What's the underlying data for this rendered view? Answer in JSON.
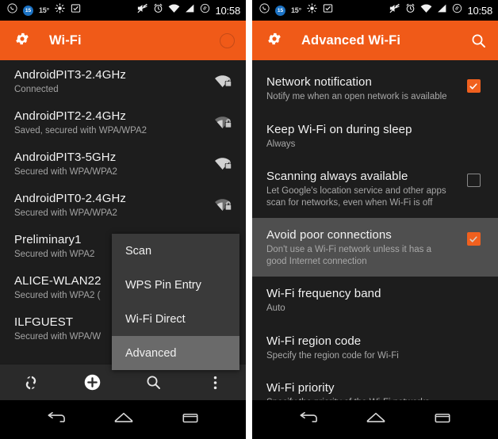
{
  "statusbar": {
    "icons_left": [
      "whatsapp-icon",
      "message-badge-icon",
      "temperature-label",
      "sun-gear-icon",
      "checkbox-app-icon"
    ],
    "temperature": "15°",
    "icons_right": [
      "mute-icon",
      "alarm-icon",
      "wifi-icon",
      "signal-icon",
      "circle-icon"
    ],
    "clock": "10:58",
    "badge_text": "15"
  },
  "left": {
    "actionbar": {
      "icon": "gear-icon",
      "title": "Wi-Fi",
      "right_icon": "progress-ring-icon"
    },
    "networks": [
      {
        "ssid": "AndroidPIT3-2.4GHz",
        "status": "Connected",
        "icon": "wifi-lock-icon",
        "bars": 4
      },
      {
        "ssid": "AndroidPIT2-2.4GHz",
        "status": "Saved, secured with WPA/WPA2",
        "icon": "wifi-lock-icon",
        "bars": 3
      },
      {
        "ssid": "AndroidPIT3-5GHz",
        "status": "Secured with WPA/WPA2",
        "icon": "wifi-lock-icon",
        "bars": 4
      },
      {
        "ssid": "AndroidPIT0-2.4GHz",
        "status": "Secured with WPA/WPA2",
        "icon": "wifi-lock-icon",
        "bars": 3
      },
      {
        "ssid": "Preliminary1",
        "status": "Secured with WPA2",
        "icon": "wifi-lock-icon",
        "bars": 3
      },
      {
        "ssid": "ALICE-WLAN22",
        "status": "Secured with WPA2 (",
        "icon": "wifi-lock-icon",
        "bars": 2
      },
      {
        "ssid": "ILFGUEST",
        "status": "Secured with WPA/W",
        "icon": "wifi-lock-icon",
        "bars": 2
      }
    ],
    "menu": {
      "items": [
        {
          "label": "Scan",
          "selected": false
        },
        {
          "label": "WPS Pin Entry",
          "selected": false
        },
        {
          "label": "Wi-Fi Direct",
          "selected": false
        },
        {
          "label": "Advanced",
          "selected": true
        }
      ]
    },
    "toolbar": [
      {
        "name": "refresh-icon"
      },
      {
        "name": "add-network-icon"
      },
      {
        "name": "search-icon"
      },
      {
        "name": "overflow-menu-icon"
      }
    ]
  },
  "right": {
    "actionbar": {
      "icon": "gear-icon",
      "title": "Advanced Wi-Fi",
      "right_icon": "search-icon"
    },
    "settings": [
      {
        "title": "Network notification",
        "sub": "Notify me when an open network is available",
        "control": "checkbox",
        "checked": true,
        "pressed": false
      },
      {
        "title": "Keep Wi-Fi on during sleep",
        "sub": "Always",
        "control": "none",
        "checked": false,
        "pressed": false
      },
      {
        "title": "Scanning always available",
        "sub": "Let Google's location service and other apps scan for networks, even when Wi-Fi is off",
        "control": "checkbox",
        "checked": false,
        "pressed": false
      },
      {
        "title": "Avoid poor connections",
        "sub": "Don't use a Wi-Fi network unless it has a good Internet connection",
        "control": "checkbox",
        "checked": true,
        "pressed": true
      },
      {
        "title": "Wi-Fi frequency band",
        "sub": "Auto",
        "control": "none",
        "checked": false,
        "pressed": false
      },
      {
        "title": "Wi-Fi region code",
        "sub": "Specify the region code for Wi-Fi",
        "control": "none",
        "checked": false,
        "pressed": false
      },
      {
        "title": "Wi-Fi priority",
        "sub": "Specify the priority of the Wi-Fi networks",
        "control": "none",
        "checked": false,
        "pressed": false
      }
    ]
  },
  "navbar": {
    "back": "back-icon",
    "home": "home-icon",
    "recents": "recents-icon"
  },
  "colors": {
    "accent": "#f05a18",
    "background": "#1d1d1d",
    "menu_bg": "#3a3a3a",
    "menu_sel": "#6a6a6a",
    "pressed_row": "#4f4f4f"
  }
}
